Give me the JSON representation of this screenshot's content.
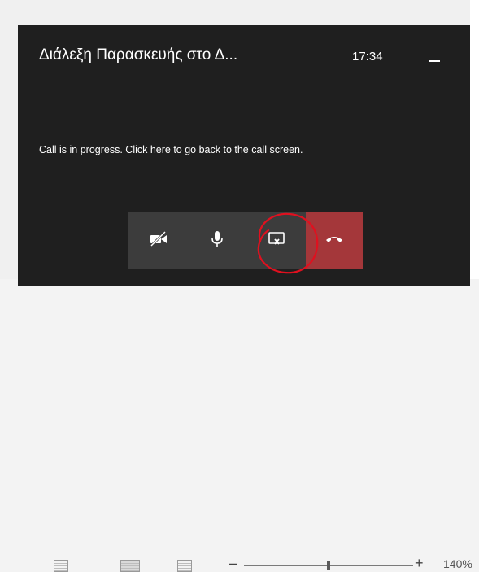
{
  "call_window": {
    "title": "Διάλεξη Παρασκευής στο Δ...",
    "timer": "17:34",
    "message": "Call is in progress. Click here to go back to the call screen."
  },
  "controls": {
    "camera": "camera-off-icon",
    "mic": "microphone-icon",
    "share": "stop-sharing-icon",
    "hangup": "hang-up-icon"
  },
  "statusbar": {
    "zoom_minus": "–",
    "zoom_plus": "+",
    "zoom_percent": "140%"
  },
  "colors": {
    "window_bg": "#1f1f1f",
    "controls_bg": "#3c3c3c",
    "hangup_bg": "#a4373a",
    "annotation": "#e0101f"
  }
}
